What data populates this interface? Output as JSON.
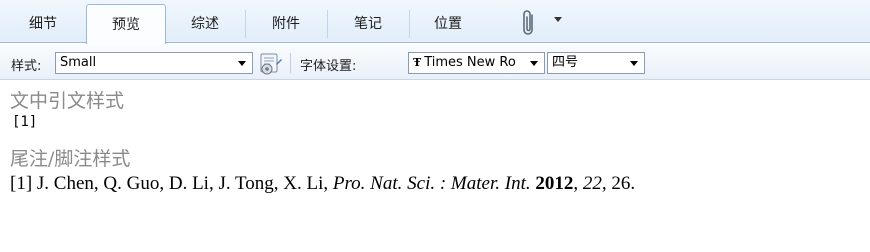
{
  "tabs": [
    {
      "label": "细节"
    },
    {
      "label": "预览"
    },
    {
      "label": "综述"
    },
    {
      "label": "附件"
    },
    {
      "label": "笔记"
    },
    {
      "label": "位置"
    }
  ],
  "tab_icons": {
    "attachment": "paperclip-icon",
    "more": "chevron-down-icon"
  },
  "toolbar": {
    "style_label": "样式:",
    "style_value": "Small",
    "settings_icon": "style-editor-icon",
    "font_label": "字体设置:",
    "font_value": "Times New Ro",
    "font_icon": "truetype-icon",
    "size_value": "四号"
  },
  "preview": {
    "intext_heading": "文中引文样式",
    "intext_citation": "[1]",
    "bib_heading": "尾注/脚注样式",
    "bib": {
      "prefix": "[1] J. Chen, Q. Guo, D. Li, J. Tong, X. Li, ",
      "journal": "Pro. Nat. Sci. : Mater. Int.",
      "space": " ",
      "year": "2012",
      "comma1": ", ",
      "volume": "22",
      "pages": ", 26."
    }
  },
  "colors": {
    "tab_border": "#9db9d8",
    "heading_gray": "#8a8a8a"
  }
}
